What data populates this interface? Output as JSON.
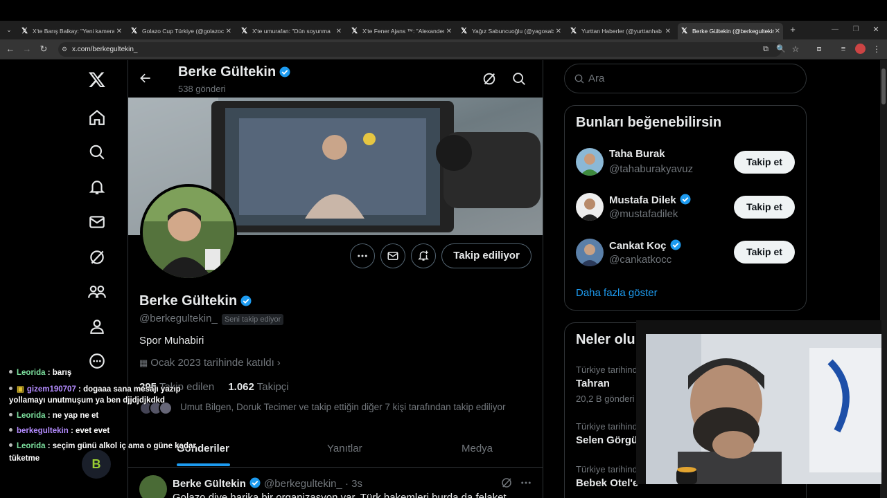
{
  "browser": {
    "tabs": [
      {
        "title": "X'te Barış Balkay: \"Yeni kamera a"
      },
      {
        "title": "Golazo Cup Türkiye (@golazoc"
      },
      {
        "title": "X'te umurafan: \"Dün soyunma"
      },
      {
        "title": "X'te Fener Ajans ™: \"Alexander"
      },
      {
        "title": "Yağız Sabuncuoğlu (@yagosab"
      },
      {
        "title": "Yurttan Haberler (@yurttanhab"
      },
      {
        "title": "Berke Gültekin (@berkegultekin"
      }
    ],
    "url": "x.com/berkegultekin_"
  },
  "header": {
    "name": "Berke Gültekin",
    "post_count": "538 gönderi"
  },
  "profile": {
    "name": "Berke Gültekin",
    "handle": "@berkegultekin_",
    "follows_you": "Seni takip ediyor",
    "bio": "Spor Muhabiri",
    "joined": "Ocak 2023 tarihinde katıldı",
    "following_count": "295",
    "following_label": "Takip edilen",
    "followers_count": "1.062",
    "followers_label": "Takipçi",
    "followed_by": "Umut Bilgen, Doruk Tecimer ve takip ettiğin diğer 7 kişi tarafından takip ediliyor",
    "follow_state": "Takip ediliyor"
  },
  "profile_tabs": [
    "Gönderiler",
    "Yanıtlar",
    "Medya"
  ],
  "post": {
    "name": "Berke Gültekin",
    "handle": "@berkegultekin_",
    "time": "· 3s",
    "text": "Golazo diye harika bir organizasyon var. Türk hakemleri burda da felaket"
  },
  "search": {
    "placeholder": "Ara"
  },
  "suggestions": {
    "title": "Bunları beğenebilirsin",
    "follow_label": "Takip et",
    "items": [
      {
        "name": "Taha Burak",
        "handle": "@tahaburakyavuz",
        "verified": false
      },
      {
        "name": "Mustafa Dilek",
        "handle": "@mustafadilek",
        "verified": true
      },
      {
        "name": "Cankat Koç",
        "handle": "@cankatkocc",
        "verified": true
      }
    ],
    "show_more": "Daha fazla göster"
  },
  "trends": {
    "title": "Neler olu",
    "items": [
      {
        "category": "Türkiye tarihinde",
        "title": "Tahran",
        "posts": "20,2 B gönderi"
      },
      {
        "category": "Türkiye tarihinde",
        "title": "Selen Görgü"
      },
      {
        "category": "Türkiye tarihinde",
        "title": "Bebek Otel'e"
      }
    ]
  },
  "chat": [
    {
      "user": "Leorida",
      "msg": ": barış"
    },
    {
      "user": "gizem190707",
      "msg": ": dogaaa sana mesajı yazıp"
    },
    {
      "user": "",
      "msg": "yollamayı unutmuşum ya ben djjdjdjkdkd"
    },
    {
      "user": "Leorida",
      "msg": ": ne yap ne et"
    },
    {
      "user": "berkegultekin",
      "msg": ": evet evet"
    },
    {
      "user": "Leorida",
      "msg": ": seçim günü alkol iç ama o güne kadar"
    },
    {
      "user": "",
      "msg": "tüketme"
    }
  ],
  "colors": {
    "accent": "#1d9bf0",
    "chat_user": "#7ee3a0",
    "chat_user2": "#b48cff"
  }
}
